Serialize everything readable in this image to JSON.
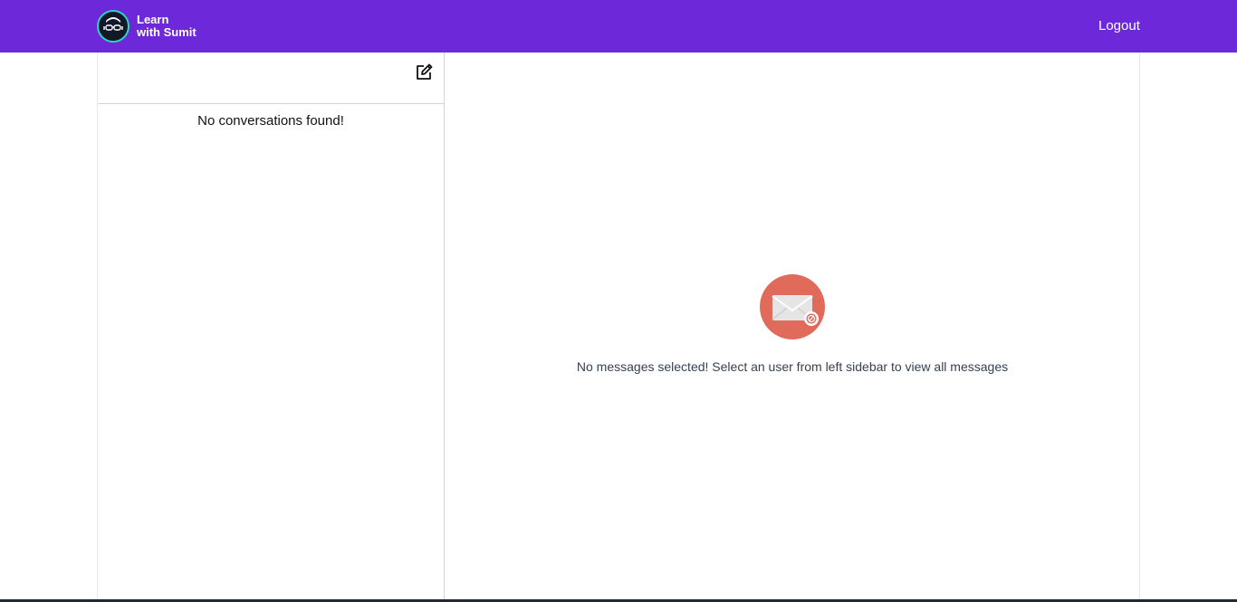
{
  "brand": {
    "line1": "Learn",
    "line2": "with Sumit",
    "logo_icon": "avatar-glasses-icon"
  },
  "nav": {
    "logout_label": "Logout"
  },
  "sidebar": {
    "compose_icon": "edit-icon",
    "empty_text": "No conversations found!"
  },
  "main": {
    "empty_icon": "mail-blocked-icon",
    "empty_text": "No messages selected! Select an user from left sidebar to view all messages"
  },
  "colors": {
    "navbar": "#6d28d9",
    "mail_circle": "#e06b5b",
    "logo_ring": "#2dd4bf"
  }
}
